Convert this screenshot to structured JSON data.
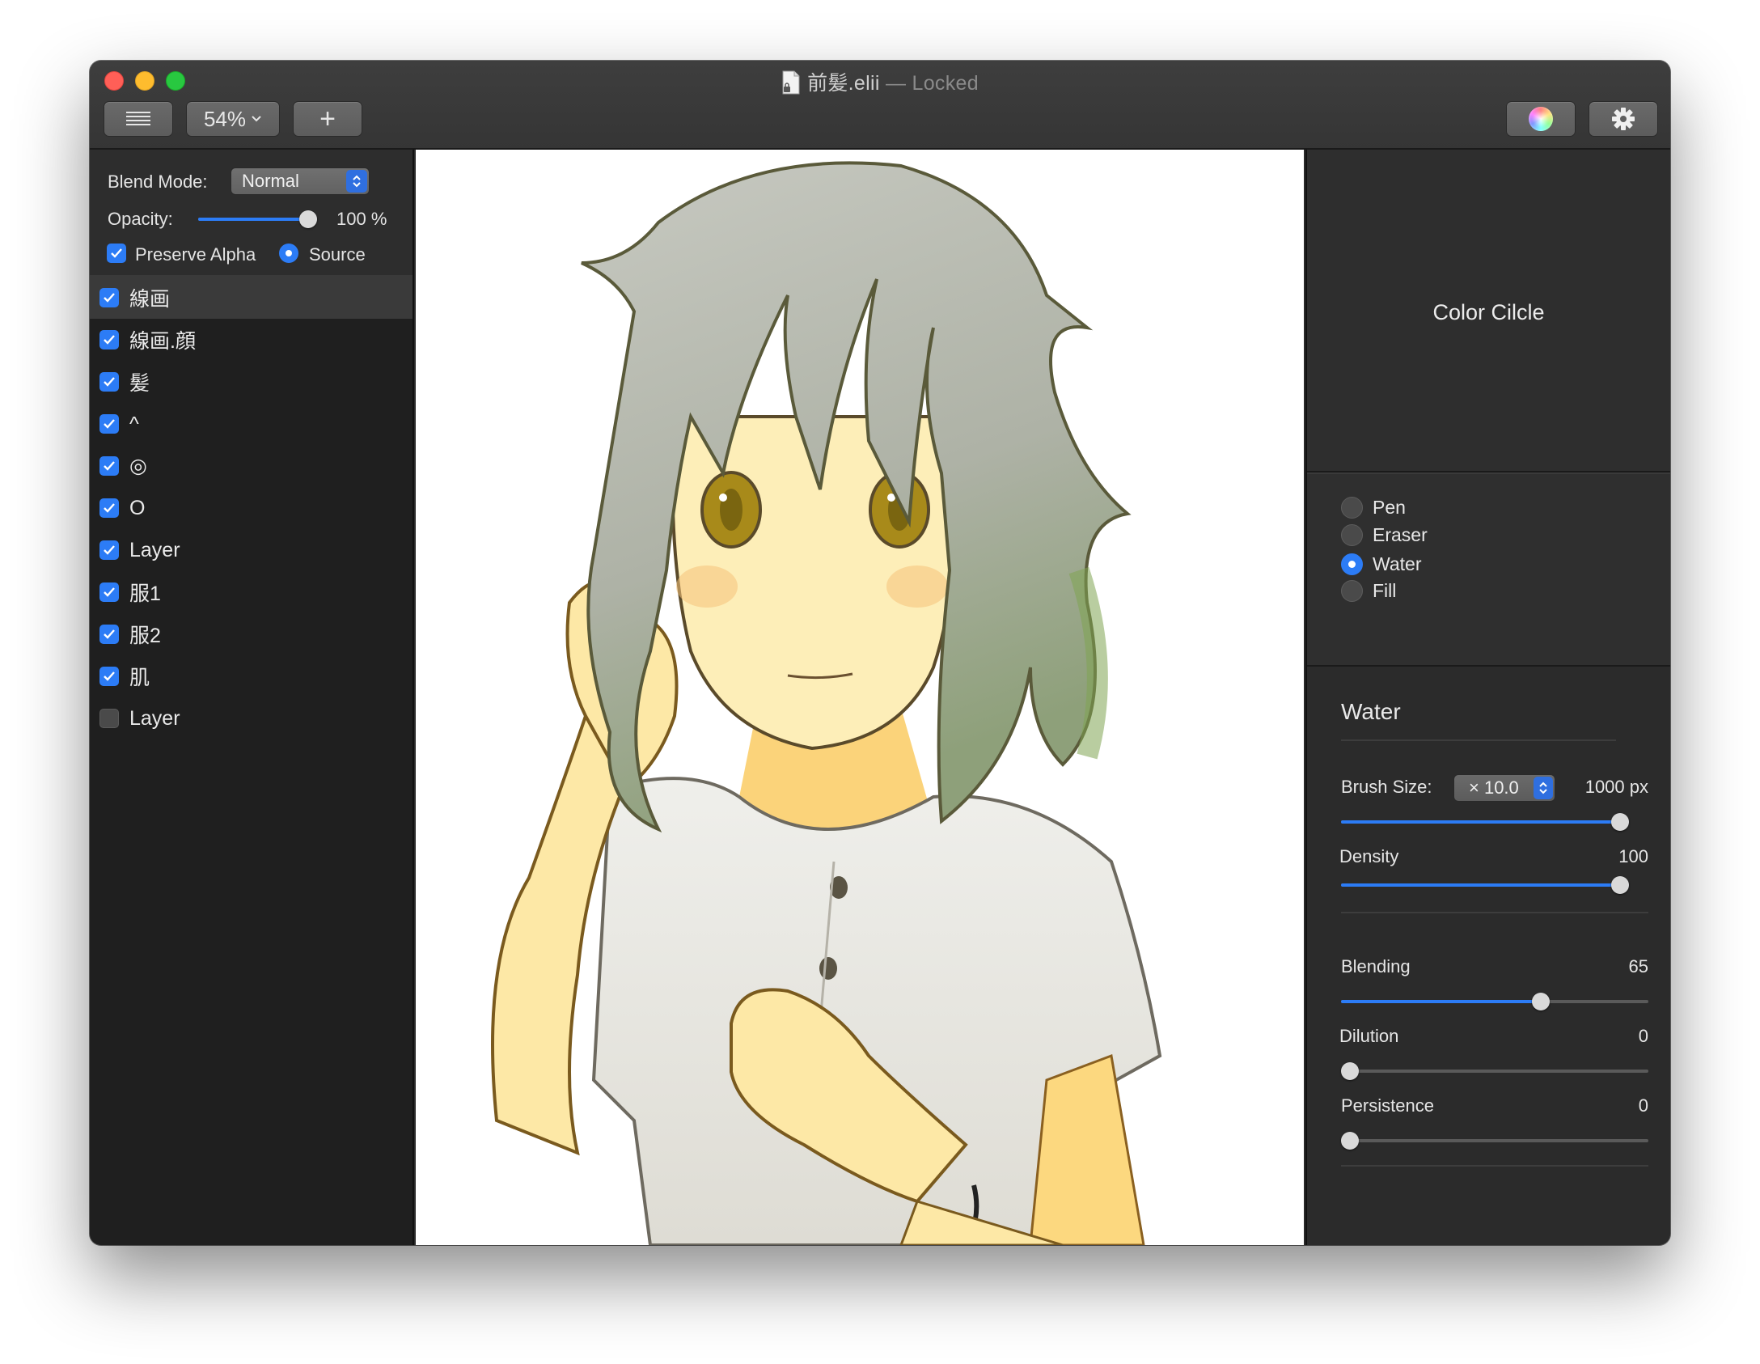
{
  "window": {
    "file_name": "前髪.elii",
    "separator": " — ",
    "status": "Locked"
  },
  "toolbar": {
    "zoom_label": "54%",
    "add_label": "+"
  },
  "layer_props": {
    "blend_label": "Blend Mode:",
    "blend_value": "Normal",
    "opacity_label": "Opacity:",
    "opacity_value": "100 %",
    "opacity_fraction": 1.0,
    "preserve_alpha_label": "Preserve Alpha",
    "preserve_alpha_checked": true,
    "source_label": "Source",
    "source_selected": true
  },
  "layers": [
    {
      "name": "線画",
      "visible": true,
      "selected": true
    },
    {
      "name": "線画.顔",
      "visible": true,
      "selected": false
    },
    {
      "name": "髪",
      "visible": true,
      "selected": false
    },
    {
      "name": "^",
      "visible": true,
      "selected": false
    },
    {
      "name": "◎",
      "visible": true,
      "selected": false
    },
    {
      "name": "O",
      "visible": true,
      "selected": false
    },
    {
      "name": "Layer",
      "visible": true,
      "selected": false
    },
    {
      "name": "服1",
      "visible": true,
      "selected": false
    },
    {
      "name": "服2",
      "visible": true,
      "selected": false
    },
    {
      "name": "肌",
      "visible": true,
      "selected": false
    },
    {
      "name": "Layer",
      "visible": false,
      "selected": false
    }
  ],
  "color_panel": {
    "caption": "Color Cilcle"
  },
  "tools": [
    {
      "name": "Pen",
      "selected": false
    },
    {
      "name": "Eraser",
      "selected": false
    },
    {
      "name": "Water",
      "selected": true
    },
    {
      "name": "Fill",
      "selected": false
    }
  ],
  "brush": {
    "title": "Water",
    "size_label": "Brush Size:",
    "size_multiplier": "× 10.0",
    "size_value": "1000 px",
    "size_fraction": 1.0,
    "density_label": "Density",
    "density_value": "100",
    "density_fraction": 1.0,
    "blending_label": "Blending",
    "blending_value": "65",
    "blending_fraction": 0.65,
    "dilution_label": "Dilution",
    "dilution_value": "0",
    "dilution_fraction": 0.0,
    "persistence_label": "Persistence",
    "persistence_value": "0",
    "persistence_fraction": 0.0
  },
  "colors": {
    "accent": "#2c7cf6",
    "skin": "#fde8a6",
    "hair": "#b9bcb2",
    "line": "#7a5a1e"
  }
}
